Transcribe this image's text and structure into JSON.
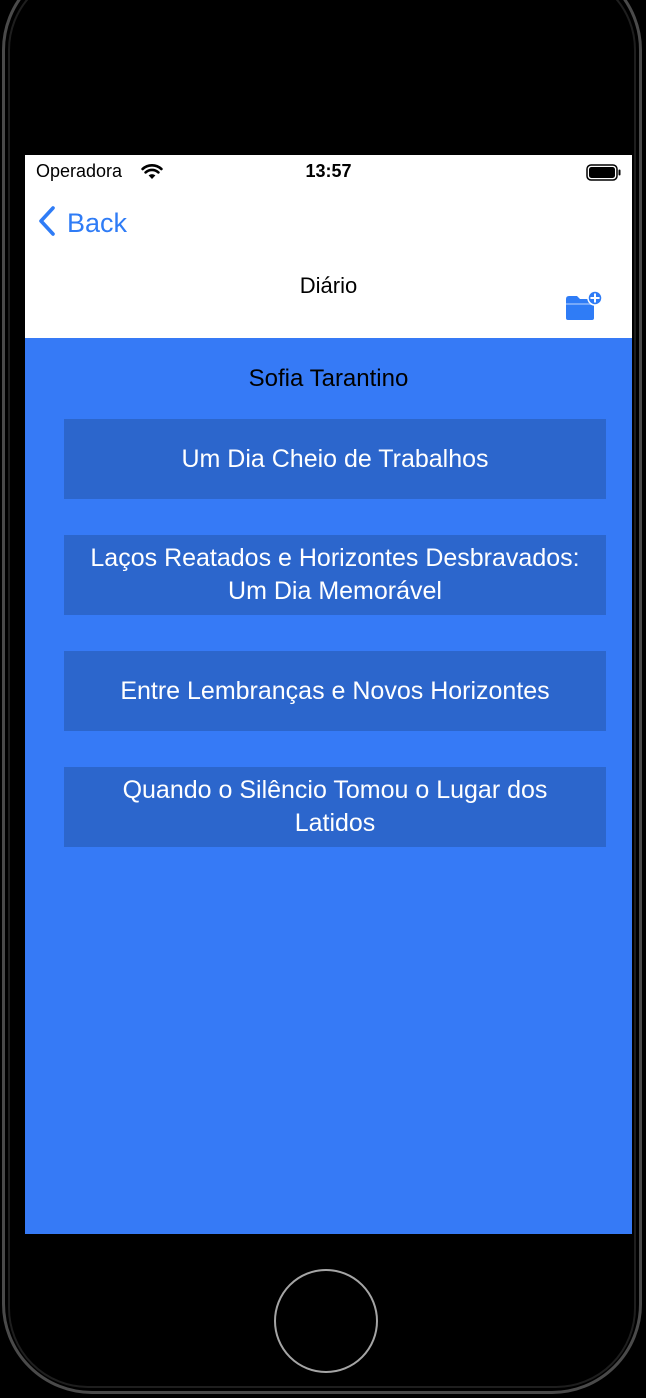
{
  "status_bar": {
    "carrier": "Operadora",
    "time": "13:57"
  },
  "nav": {
    "back_label": "Back",
    "title": "Diário"
  },
  "owner_name": "Sofia Tarantino",
  "entries": [
    {
      "title": "Um Dia Cheio de Trabalhos"
    },
    {
      "title": "Laços Reatados e Horizontes Desbravados: Um Dia Memorável"
    },
    {
      "title": "Entre Lembranças e Novos Horizontes"
    },
    {
      "title": "Quando o Silêncio Tomou o Lugar dos Latidos"
    }
  ],
  "icons": {
    "signal": "wifi-icon",
    "battery": "battery-icon",
    "back": "chevron-left-icon",
    "add_folder": "folder-add-icon"
  },
  "colors": {
    "accent": "#2f7cf6",
    "background": "#367af6",
    "entry_background": "#2c66cc",
    "entry_text": "#ffffff"
  }
}
